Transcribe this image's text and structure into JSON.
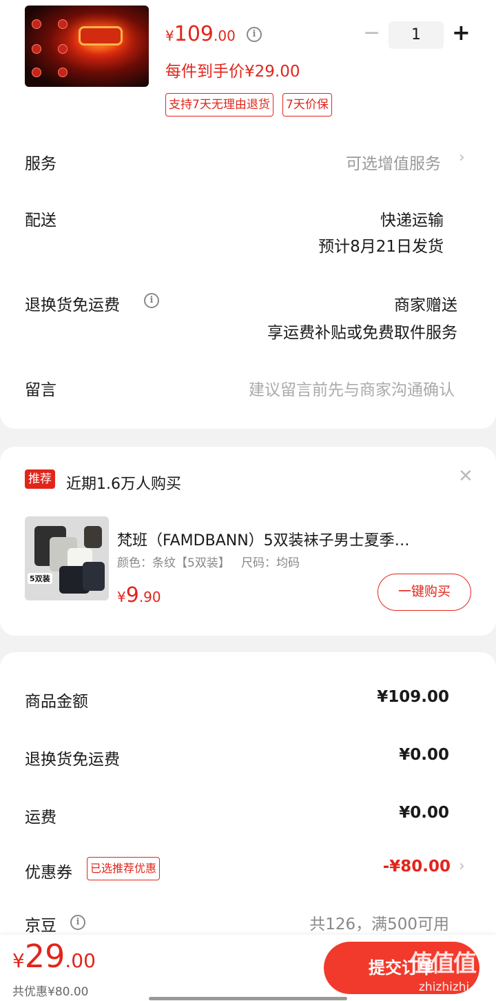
{
  "product": {
    "currency_symbol": "¥",
    "price_int": "109",
    "price_dec": ".00",
    "final_price_label": "每件到手价¥29.00",
    "quantity": "1",
    "minus": "−",
    "plus": "+",
    "tags": [
      "支持7天无理由退货",
      "7天价保"
    ],
    "image_icon": "bike-tail-light-image"
  },
  "rows": {
    "service": {
      "label": "服务",
      "value": "可选增值服务"
    },
    "delivery": {
      "label": "配送",
      "value_line1": "快递运输",
      "value_line2": "预计8月21日发货"
    },
    "return_shipping": {
      "label": "退换货免运费",
      "value_line1": "商家赠送",
      "value_line2": "享运费补贴或免费取件服务"
    },
    "message": {
      "label": "留言",
      "placeholder": "建议留言前先与商家沟通确认"
    }
  },
  "recommend": {
    "badge": "推荐",
    "title": "近期1.6万人购买",
    "product_name": "梵班（FAMDBANN）5双装袜子男士夏季…",
    "spec": "颜色：条纹【5双装】   尺码：均码",
    "price_symbol": "¥",
    "price_int": "9",
    "price_dec": ".90",
    "buy_label": "一键购买",
    "pack_label": "5双装"
  },
  "summary": {
    "goods_amount": {
      "label": "商品金额",
      "value": "¥109.00"
    },
    "return_fee": {
      "label": "退换货免运费",
      "value": "¥0.00"
    },
    "shipping": {
      "label": "运费",
      "value": "¥0.00"
    },
    "coupon": {
      "label": "优惠券",
      "tag": "已选推荐优惠",
      "value": "-¥80.00"
    },
    "jingdou": {
      "label": "京豆",
      "value": "共126，满500可用"
    }
  },
  "bottom": {
    "currency_symbol": "¥",
    "total_int": "29",
    "total_dec": ".00",
    "discount_text": "共优惠¥80.00",
    "submit_label": "提交订单",
    "watermark": "值值值",
    "watermark_sub": "zhizhizhi.com"
  },
  "colors": {
    "accent": "#e1251b",
    "submit": "#f13a2c",
    "background": "#f2f2f2"
  }
}
